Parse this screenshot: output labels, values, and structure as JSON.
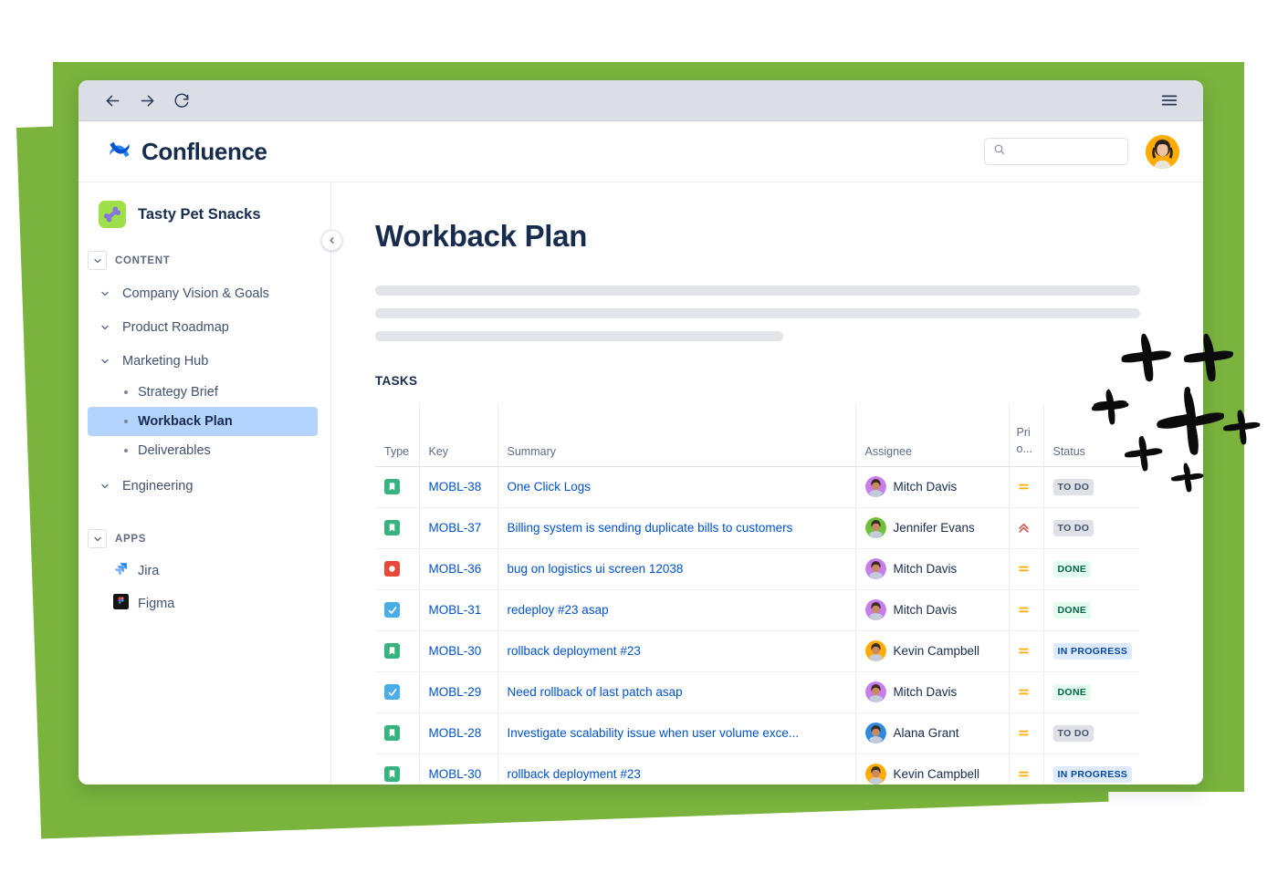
{
  "browser": {
    "back_icon": "arrow-left-icon",
    "forward_icon": "arrow-right-icon",
    "reload_icon": "reload-icon",
    "menu_icon": "hamburger-menu-icon"
  },
  "header": {
    "brand": "Confluence",
    "brand_icon": "confluence-logo-icon",
    "search_placeholder": "",
    "search_value": "",
    "search_icon": "search-icon",
    "avatar_icon": "user-avatar"
  },
  "sidebar": {
    "space_name": "Tasty Pet Snacks",
    "space_icon": "dog-bone-icon",
    "collapse_icon": "chevron-left-icon",
    "sections": [
      {
        "label": "CONTENT",
        "items": [
          {
            "label": "Company Vision & Goals",
            "caret": "chevron-down-icon",
            "active": false
          },
          {
            "label": "Product Roadmap",
            "caret": "chevron-down-icon",
            "active": false
          },
          {
            "label": "Marketing Hub",
            "caret": "chevron-down-icon",
            "active": false
          }
        ],
        "children": [
          {
            "label": "Strategy Brief",
            "active": false
          },
          {
            "label": "Workback Plan",
            "active": true
          },
          {
            "label": "Deliverables",
            "active": false
          }
        ],
        "trailing": [
          {
            "label": "Engineering",
            "caret": "chevron-down-icon",
            "active": false
          }
        ]
      },
      {
        "label": "APPS",
        "apps": [
          {
            "label": "Jira",
            "icon": "jira-icon"
          },
          {
            "label": "Figma",
            "icon": "figma-icon"
          }
        ]
      }
    ]
  },
  "main": {
    "title": "Workback Plan",
    "tasks_heading": "TASKS",
    "skeleton_widths": [
      "100%",
      "100%",
      "53%"
    ],
    "table": {
      "columns": [
        {
          "key": "type",
          "label": "Type"
        },
        {
          "key": "key",
          "label": "Key"
        },
        {
          "key": "summary",
          "label": "Summary"
        },
        {
          "key": "assignee",
          "label": "Assignee"
        },
        {
          "key": "priority",
          "label_line1": "Pri",
          "label_line2": "o..."
        },
        {
          "key": "status",
          "label": "Status"
        }
      ],
      "rows": [
        {
          "type": "story",
          "key": "MOBL-38",
          "summary": "One Click Logs",
          "assignee": "Mitch Davis",
          "avatar_color": "#C77DEB",
          "priority": "medium",
          "status": "TO DO",
          "status_class": "badge-todo"
        },
        {
          "type": "story",
          "key": "MOBL-37",
          "summary": "Billing system is sending duplicate bills to customers",
          "assignee": "Jennifer Evans",
          "avatar_color": "#6FC13B",
          "priority": "highest",
          "status": "TO DO",
          "status_class": "badge-todo"
        },
        {
          "type": "bug",
          "key": "MOBL-36",
          "summary": "bug on logistics ui screen 12038",
          "assignee": "Mitch Davis",
          "avatar_color": "#C77DEB",
          "priority": "medium",
          "status": "DONE",
          "status_class": "badge-done"
        },
        {
          "type": "task",
          "key": "MOBL-31",
          "summary": "redeploy #23 asap",
          "assignee": "Mitch Davis",
          "avatar_color": "#C77DEB",
          "priority": "medium",
          "status": "DONE",
          "status_class": "badge-done"
        },
        {
          "type": "story",
          "key": "MOBL-30",
          "summary": "rollback deployment #23",
          "assignee": "Kevin Campbell",
          "avatar_color": "#FFAB00",
          "priority": "medium",
          "status": "IN PROGRESS",
          "status_class": "badge-progress"
        },
        {
          "type": "task",
          "key": "MOBL-29",
          "summary": "Need rollback of last patch asap",
          "assignee": "Mitch Davis",
          "avatar_color": "#C77DEB",
          "priority": "medium",
          "status": "DONE",
          "status_class": "badge-done"
        },
        {
          "type": "story",
          "key": "MOBL-28",
          "summary": "Investigate scalability issue when user volume exce...",
          "assignee": "Alana Grant",
          "avatar_color": "#2E8ADE",
          "priority": "medium",
          "status": "TO DO",
          "status_class": "badge-todo"
        },
        {
          "type": "story",
          "key": "MOBL-30",
          "summary": "rollback deployment #23",
          "assignee": "Kevin Campbell",
          "avatar_color": "#FFAB00",
          "priority": "medium",
          "status": "IN PROGRESS",
          "status_class": "badge-progress"
        }
      ]
    }
  },
  "decor": {
    "green": "#7AB43C",
    "sparkle_color": "#0B0B0B",
    "sparkle_count": 8
  },
  "colors": {
    "link": "#0052CC",
    "text": "#172B4D",
    "muted": "#5E6C84",
    "story": "#36B37E",
    "bug": "#E5493A",
    "task": "#4BADE8",
    "priority_medium": "#FFAB00",
    "priority_highest": "#CD5B52",
    "active_nav": "#B3D4FF"
  }
}
